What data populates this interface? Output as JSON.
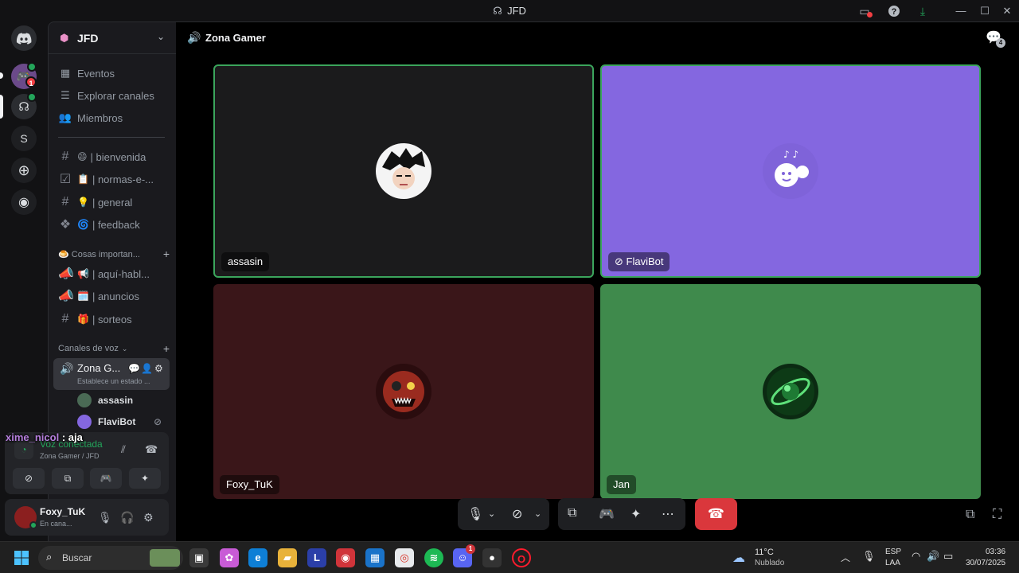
{
  "window": {
    "title": "JFD"
  },
  "server": {
    "name": "JFD"
  },
  "nav": [
    {
      "label": "Eventos",
      "icon": "calendar-icon"
    },
    {
      "label": "Explorar canales",
      "icon": "list-icon"
    },
    {
      "label": "Miembros",
      "icon": "members-icon"
    }
  ],
  "text_channels": [
    {
      "emoji": "😄",
      "label": "| bienvenida"
    },
    {
      "emoji": "📋",
      "label": "| normas-e-..."
    },
    {
      "emoji": "💡",
      "label": "| general"
    },
    {
      "emoji": "🌀",
      "label": "| feedback"
    }
  ],
  "category_important": {
    "label": "🍮 Cosas importan...",
    "channels": [
      {
        "emoji": "📢",
        "label": "| aquí-habl..."
      },
      {
        "emoji": "🗓️",
        "label": "| anuncios"
      },
      {
        "emoji": "🎁",
        "label": "| sorteos"
      }
    ]
  },
  "voice_category": {
    "label": "Canales de voz"
  },
  "voice_channel": {
    "name": "Zona G...",
    "status": "Establece un estado ..."
  },
  "voice_members": [
    {
      "name": "assasin"
    },
    {
      "name": "FlaviBot"
    }
  ],
  "chat_overlay": {
    "nick": "xime_nicol",
    "message": " : aja"
  },
  "voice_panel": {
    "status": "Voz conectada",
    "location": "Zona Gamer / JFD"
  },
  "user": {
    "name": "Foxy_TuK",
    "status": "En cana..."
  },
  "main": {
    "channel_title": "Zona Gamer",
    "chat_count": "4"
  },
  "tiles": [
    {
      "name": "assasin",
      "bg": "#1b1b1c",
      "border": "#3ba55c"
    },
    {
      "name": "FlaviBot",
      "bg": "#8467e0",
      "border": "#3ba55c"
    },
    {
      "name": "Foxy_TuK",
      "bg": "#3a1619",
      "border": "none"
    },
    {
      "name": "Jan",
      "bg": "#3f8a4c",
      "border": "none"
    }
  ],
  "taskbar": {
    "search_placeholder": "Buscar",
    "weather_temp": "11°C",
    "weather_desc": "Nublado",
    "lang_top": "ESP",
    "lang_bottom": "LAA",
    "time": "03:36",
    "date": "30/07/2025",
    "discord_badge": "1"
  },
  "rail_badge": "1",
  "colors": {
    "accent": "#5865f2",
    "online": "#23a55a",
    "danger": "#da373c"
  }
}
